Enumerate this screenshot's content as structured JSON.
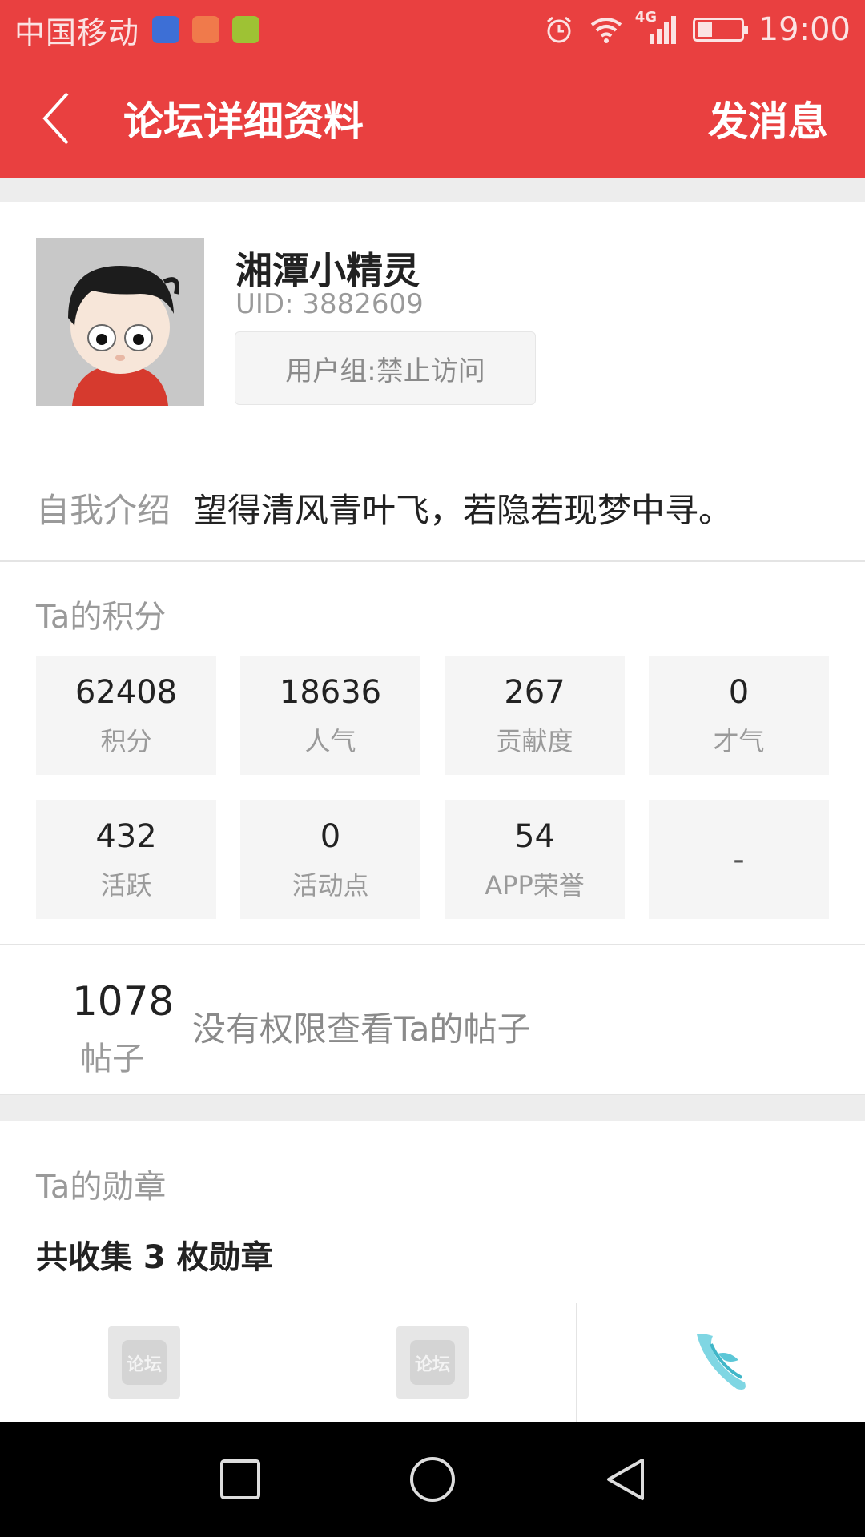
{
  "status_bar": {
    "carrier": "中国移动",
    "network": "4G",
    "time": "19:00",
    "icons": [
      "wifi-signal-app-icon",
      "mail-app-icon",
      "chat-app-icon",
      "alarm-icon",
      "wifi-icon",
      "cellular-signal-icon",
      "battery-icon"
    ]
  },
  "header": {
    "title": "论坛详细资料",
    "action_label": "发消息",
    "back_icon": "chevron-left-icon",
    "background": "#e94040"
  },
  "profile": {
    "username": "湘潭小精灵",
    "uid": "UID: 3882609",
    "user_group": "用户组:禁止访问",
    "intro_label": "自我介绍",
    "intro_text": "望得清风青叶飞，若隐若现梦中寻。"
  },
  "scores": {
    "section_label": "Ta的积分",
    "items": [
      {
        "value": "62408",
        "label": "积分"
      },
      {
        "value": "18636",
        "label": "人气"
      },
      {
        "value": "267",
        "label": "贡献度"
      },
      {
        "value": "0",
        "label": "才气"
      },
      {
        "value": "432",
        "label": "活跃"
      },
      {
        "value": "0",
        "label": "活动点"
      },
      {
        "value": "54",
        "label": "APP荣誉"
      },
      {
        "value": "-",
        "label": ""
      }
    ]
  },
  "posts": {
    "count": "1078",
    "label": "帖子",
    "message": "没有权限查看Ta的帖子"
  },
  "medals": {
    "section_label": "Ta的勋章",
    "summary": "共收集 3 枚勋章",
    "items": [
      {
        "icon": "forum-medal-icon",
        "text": "论坛"
      },
      {
        "icon": "forum-medal-icon",
        "text": "论坛"
      },
      {
        "icon": "wing-medal-icon"
      }
    ]
  },
  "nav_bar": {
    "buttons": [
      "recent-apps-icon",
      "home-icon",
      "back-triangle-icon"
    ]
  }
}
